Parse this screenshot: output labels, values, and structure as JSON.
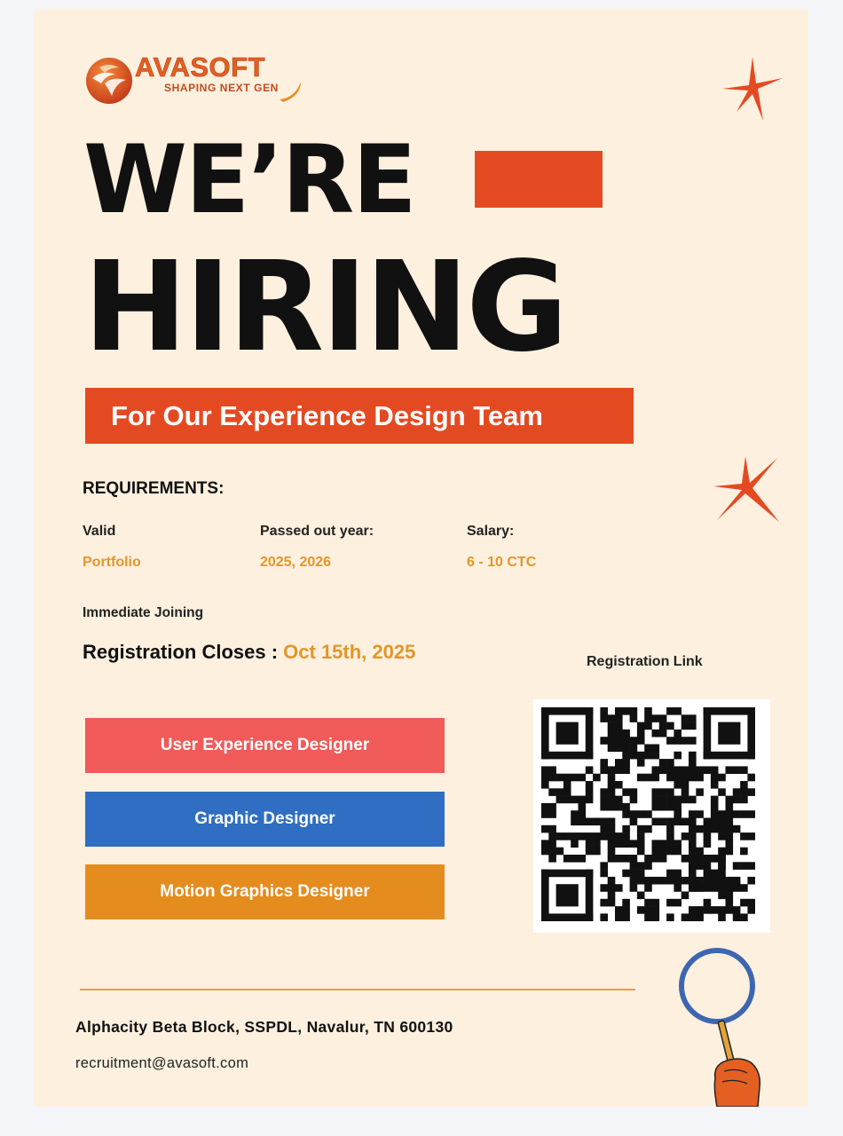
{
  "brand": {
    "name": "AVASOFT",
    "tagline": "SHAPING NEXT GEN"
  },
  "headline": {
    "line1": "WE’RE",
    "line2": "HIRING"
  },
  "team_banner": "For Our Experience Design Team",
  "requirements": {
    "title": "REQUIREMENTS:",
    "items": [
      {
        "label": "Valid",
        "value": "Portfolio"
      },
      {
        "label": "Passed out year:",
        "value": "2025, 2026"
      },
      {
        "label": "Salary:",
        "value": "6 - 10 CTC"
      }
    ],
    "joining": "Immediate Joining"
  },
  "registration": {
    "label": "Registration Closes : ",
    "date": "Oct 15th, 2025",
    "link_label": "Registration Link"
  },
  "roles": [
    {
      "label": "User Experience Designer",
      "color": "#f05b59"
    },
    {
      "label": "Graphic Designer",
      "color": "#2f6ec2"
    },
    {
      "label": "Motion Graphics Designer",
      "color": "#e58c1f"
    }
  ],
  "footer": {
    "address": "Alphacity Beta Block, SSPDL, Navalur, TN 600130",
    "email": "recruitment@avasoft.com"
  },
  "colors": {
    "background": "#fdf0df",
    "accent": "#e44a22",
    "highlight": "#e2962a"
  },
  "icons": [
    "avasoft-logo-icon",
    "sparkle-icon",
    "qr-code-icon",
    "magnifier-icon"
  ]
}
